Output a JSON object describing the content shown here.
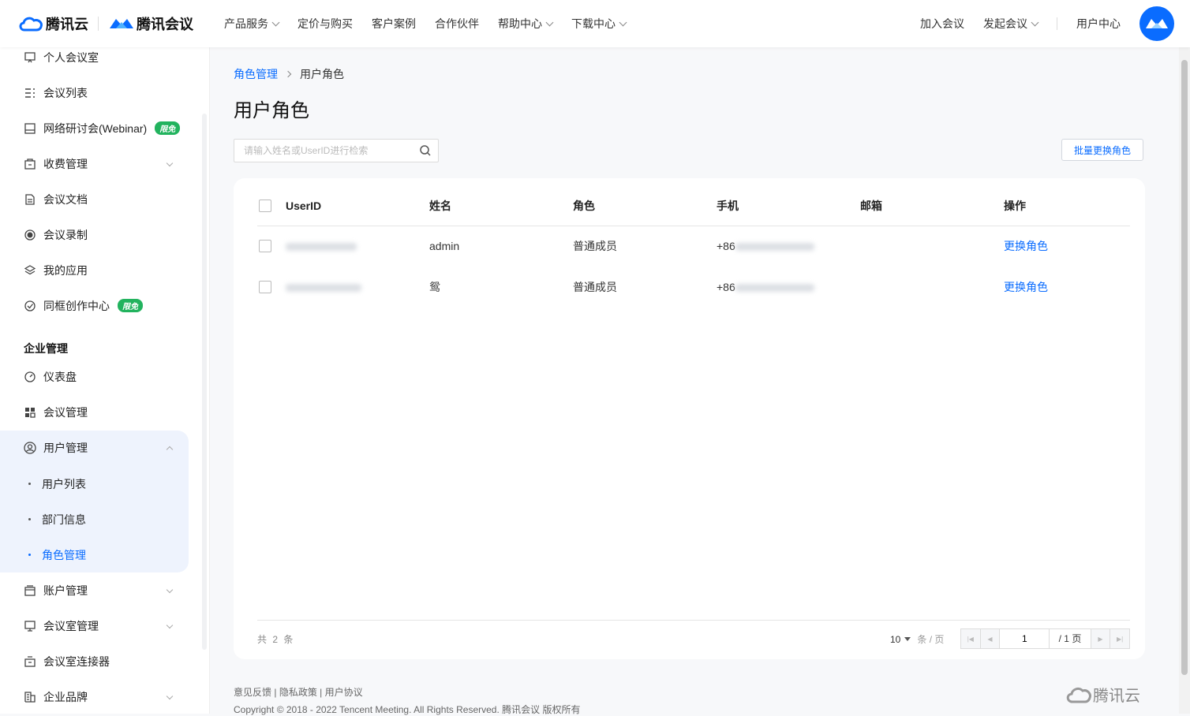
{
  "header": {
    "brand_cloud": "腾讯云",
    "brand_meeting": "腾讯会议",
    "nav": [
      {
        "label": "产品服务"
      },
      {
        "label": "定价与购买"
      },
      {
        "label": "客户案例"
      },
      {
        "label": "合作伙伴"
      },
      {
        "label": "帮助中心"
      },
      {
        "label": "下载中心"
      }
    ],
    "right": {
      "join": "加入会议",
      "start": "发起会议",
      "user_center": "用户中心"
    }
  },
  "sidebar": {
    "items_top": [
      {
        "label": "个人会议室",
        "icon": "meeting-room-icon"
      },
      {
        "label": "会议列表",
        "icon": "list-icon"
      },
      {
        "label": "网络研讨会(Webinar)",
        "icon": "webinar-icon",
        "badge": "限免"
      },
      {
        "label": "收费管理",
        "icon": "billing-icon"
      },
      {
        "label": "会议文档",
        "icon": "document-icon"
      },
      {
        "label": "会议录制",
        "icon": "record-icon"
      },
      {
        "label": "我的应用",
        "icon": "apps-icon"
      },
      {
        "label": "同框创作中心",
        "icon": "creation-icon",
        "badge": "限免"
      }
    ],
    "section_title": "企业管理",
    "items_enterprise": [
      {
        "label": "仪表盘",
        "icon": "dashboard-icon"
      },
      {
        "label": "会议管理",
        "icon": "grid-icon"
      },
      {
        "label": "用户管理",
        "icon": "user-manage-icon"
      }
    ],
    "sub_items": [
      {
        "label": "用户列表"
      },
      {
        "label": "部门信息"
      },
      {
        "label": "角色管理"
      }
    ],
    "items_bottom": [
      {
        "label": "账户管理",
        "icon": "account-icon"
      },
      {
        "label": "会议室管理",
        "icon": "room-manage-icon"
      },
      {
        "label": "会议室连接器",
        "icon": "connector-icon"
      },
      {
        "label": "企业品牌",
        "icon": "brand-icon"
      }
    ]
  },
  "main": {
    "breadcrumb": {
      "parent": "角色管理",
      "current": "用户角色"
    },
    "title": "用户角色",
    "search_placeholder": "请输入姓名或UserID进行检索",
    "batch_button": "批量更换角色",
    "table": {
      "headers": [
        "UserID",
        "姓名",
        "角色",
        "手机",
        "邮箱",
        "操作"
      ],
      "rows": [
        {
          "name": "admin",
          "role": "普通成员",
          "phone_prefix": "+86",
          "email": "",
          "action": "更换角色"
        },
        {
          "name": "鸳",
          "role": "普通成员",
          "phone_prefix": "+86",
          "email": "",
          "action": "更换角色"
        }
      ]
    },
    "pagination": {
      "total": "共 2 条",
      "page_size": "10",
      "page_size_unit": "条 / 页",
      "current_page": "1",
      "total_pages": "/ 1 页"
    }
  },
  "footer": {
    "links": [
      "意见反馈",
      "隐私政策",
      "用户协议"
    ],
    "copyright": "Copyright © 2018 - 2022 Tencent Meeting. All Rights Reserved. 腾讯会议 版权所有",
    "logo_text": "腾讯云"
  },
  "colors": {
    "accent": "#0a6cff",
    "badge": "#22b35e"
  }
}
